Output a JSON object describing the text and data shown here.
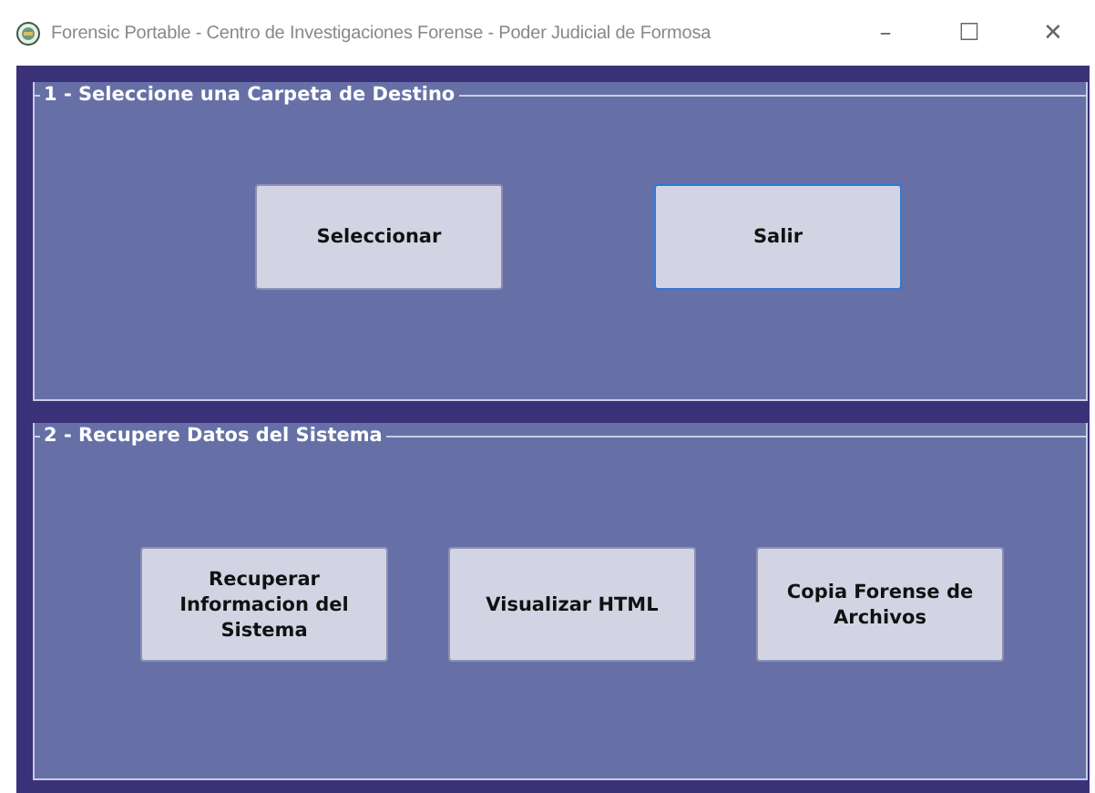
{
  "window": {
    "title": "Forensic Portable - Centro de Investigaciones Forense - Poder Judicial de Formosa",
    "controls": [
      "–",
      "☐",
      "✕"
    ]
  },
  "groups": [
    {
      "title": "1 - Seleccione una Carpeta de Destino",
      "buttons": [
        {
          "label": "Seleccionar",
          "focused": false
        },
        {
          "label": "Salir",
          "focused": true
        }
      ]
    },
    {
      "title": "2 - Recupere Datos del Sistema",
      "buttons": [
        {
          "label": "Recuperar Informacion del Sistema",
          "focused": false
        },
        {
          "label": "Visualizar HTML",
          "focused": false
        },
        {
          "label": "Copia Forense de Archivos",
          "focused": false
        }
      ]
    }
  ]
}
